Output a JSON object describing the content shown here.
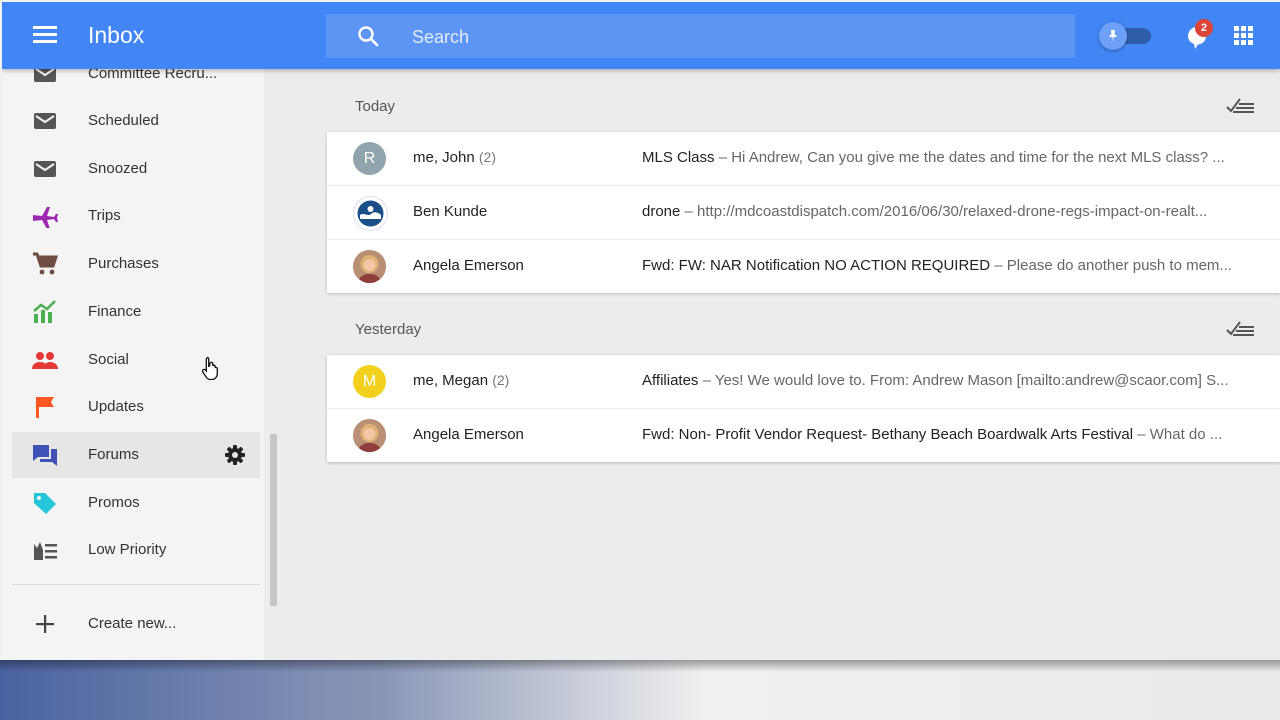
{
  "header": {
    "app_title": "Inbox",
    "search_placeholder": "Search",
    "reminders_badge": "2",
    "accent_color": "#4285f4"
  },
  "sidebar": {
    "items": [
      {
        "label": "Committee Recru...",
        "icon": "mail-icon"
      },
      {
        "label": "Scheduled",
        "icon": "scheduled-icon"
      },
      {
        "label": "Snoozed",
        "icon": "snoozed-icon"
      },
      {
        "label": "Trips",
        "icon": "plane-icon"
      },
      {
        "label": "Purchases",
        "icon": "cart-icon"
      },
      {
        "label": "Finance",
        "icon": "chart-icon"
      },
      {
        "label": "Social",
        "icon": "people-icon"
      },
      {
        "label": "Updates",
        "icon": "flag-icon"
      },
      {
        "label": "Forums",
        "icon": "forum-icon"
      },
      {
        "label": "Promos",
        "icon": "tag-icon"
      },
      {
        "label": "Low Priority",
        "icon": "low-priority-icon"
      }
    ],
    "create_new": "Create new..."
  },
  "sections": [
    {
      "title": "Today",
      "emails": [
        {
          "avatar": "R",
          "avatar_color": "#90a4ae",
          "sender": "me, John",
          "count": "(2)",
          "subject": "MLS Class",
          "snippet": " – Hi Andrew, Can you give me the dates and time for the next MLS class? ..."
        },
        {
          "avatar": "",
          "avatar_color": "#1a4f8a",
          "sender": "Ben Kunde",
          "count": "",
          "subject": "drone",
          "snippet": " – http://mdcoastdispatch.com/2016/06/30/relaxed-drone-regs-impact-on-realt..."
        },
        {
          "avatar": "",
          "avatar_color": "#c79a7c",
          "sender": "Angela Emerson",
          "count": "",
          "subject": "Fwd: FW: NAR Notification NO ACTION REQUIRED",
          "snippet": " – Please do another push to mem..."
        }
      ]
    },
    {
      "title": "Yesterday",
      "emails": [
        {
          "avatar": "M",
          "avatar_color": "#f4d01e",
          "sender": "me, Megan",
          "count": "(2)",
          "subject": "Affiliates",
          "snippet": " – Yes! We would love to. From: Andrew Mason [mailto:andrew@scaor.com] S..."
        },
        {
          "avatar": "",
          "avatar_color": "#c79a7c",
          "sender": "Angela Emerson",
          "count": "",
          "subject": "Fwd: Non- Profit Vendor Request- Bethany Beach Boardwalk Arts Festival",
          "snippet": " – What do ..."
        }
      ]
    }
  ]
}
